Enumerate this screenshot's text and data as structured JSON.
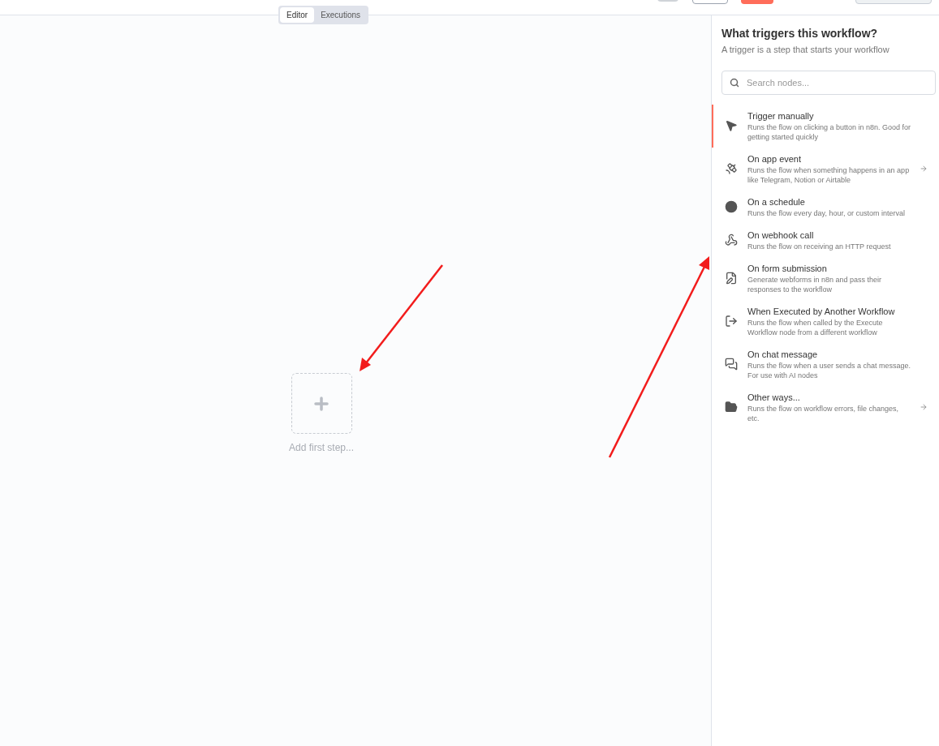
{
  "view_tabs": [
    {
      "label": "Editor",
      "selected": true
    },
    {
      "label": "Executions",
      "selected": false
    }
  ],
  "canvas": {
    "add_step_label": "Add first step..."
  },
  "panel": {
    "title": "What triggers this workflow?",
    "subtitle": "A trigger is a step that starts your workflow",
    "search": {
      "placeholder": "Search nodes..."
    },
    "items": [
      {
        "title": "Trigger manually",
        "description": "Runs the flow on clicking a button in n8n. Good for getting started quickly",
        "selected": true,
        "has_submenu": false
      },
      {
        "title": "On app event",
        "description": "Runs the flow when something happens in an app like Telegram, Notion or Airtable",
        "selected": false,
        "has_submenu": true
      },
      {
        "title": "On a schedule",
        "description": "Runs the flow every day, hour, or custom interval",
        "selected": false,
        "has_submenu": false
      },
      {
        "title": "On webhook call",
        "description": "Runs the flow on receiving an HTTP request",
        "selected": false,
        "has_submenu": false
      },
      {
        "title": "On form submission",
        "description": "Generate webforms in n8n and pass their responses to the workflow",
        "selected": false,
        "has_submenu": false
      },
      {
        "title": "When Executed by Another Workflow",
        "description": "Runs the flow when called by the Execute Workflow node from a different workflow",
        "selected": false,
        "has_submenu": false
      },
      {
        "title": "On chat message",
        "description": "Runs the flow when a user sends a chat message. For use with AI nodes",
        "selected": false,
        "has_submenu": false
      },
      {
        "title": "Other ways...",
        "description": "Runs the flow on workflow errors, file changes, etc.",
        "selected": false,
        "has_submenu": true
      }
    ]
  }
}
